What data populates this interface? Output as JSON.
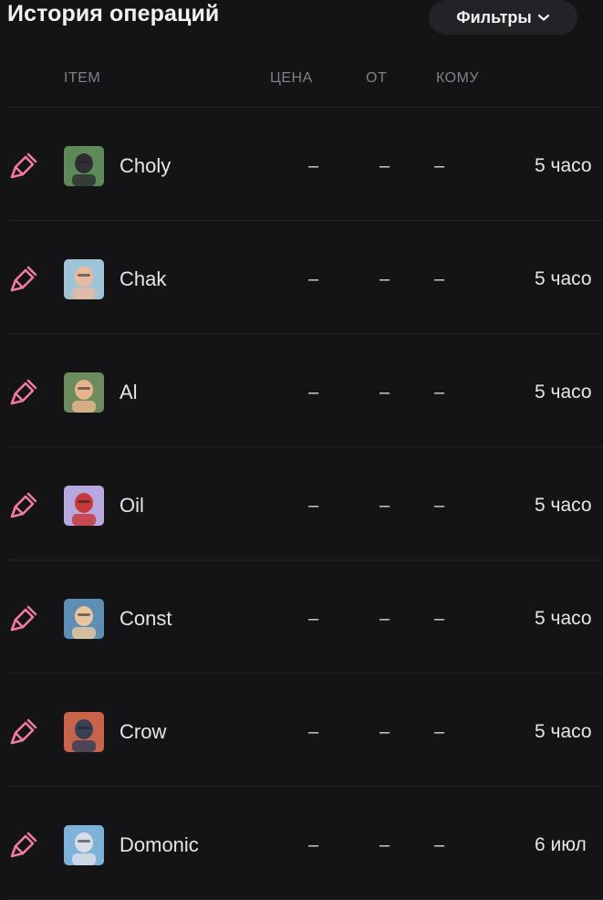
{
  "header": {
    "title": "История операций",
    "filters_label": "Фильтры",
    "filters_icon": "chevron-down-icon"
  },
  "columns": {
    "item": "ITEM",
    "price": "ЦЕНА",
    "from": "ОТ",
    "to": "КОМУ"
  },
  "colors": {
    "background": "#141417",
    "accent_pink": "#f07aa0",
    "muted_text": "#7f8088"
  },
  "rows": [
    {
      "icon": "brush-icon",
      "name": "Choly",
      "price": "–",
      "from": "–",
      "to": "–",
      "time": "5 часо",
      "avatar_bg": "#5e8a5a",
      "avatar_fg": "#2f2f33"
    },
    {
      "icon": "brush-icon",
      "name": "Chak",
      "price": "–",
      "from": "–",
      "to": "–",
      "time": "5 часо",
      "avatar_bg": "#9fc4d8",
      "avatar_fg": "#e9b9a0"
    },
    {
      "icon": "brush-icon",
      "name": "Al",
      "price": "–",
      "from": "–",
      "to": "–",
      "time": "5 часо",
      "avatar_bg": "#6c8c5e",
      "avatar_fg": "#e8b48c"
    },
    {
      "icon": "brush-icon",
      "name": "Oil",
      "price": "–",
      "from": "–",
      "to": "–",
      "time": "5 часо",
      "avatar_bg": "#b8a8e0",
      "avatar_fg": "#c83a3a"
    },
    {
      "icon": "brush-icon",
      "name": "Const",
      "price": "–",
      "from": "–",
      "to": "–",
      "time": "5 часо",
      "avatar_bg": "#5f8eb5",
      "avatar_fg": "#e8c59e"
    },
    {
      "icon": "brush-icon",
      "name": "Crow",
      "price": "–",
      "from": "–",
      "to": "–",
      "time": "5 часо",
      "avatar_bg": "#c8644a",
      "avatar_fg": "#3a3f58"
    },
    {
      "icon": "brush-icon",
      "name": "Domonic",
      "price": "–",
      "from": "–",
      "to": "–",
      "time": "6 июл",
      "avatar_bg": "#7fb2d8",
      "avatar_fg": "#d8dde8"
    }
  ]
}
